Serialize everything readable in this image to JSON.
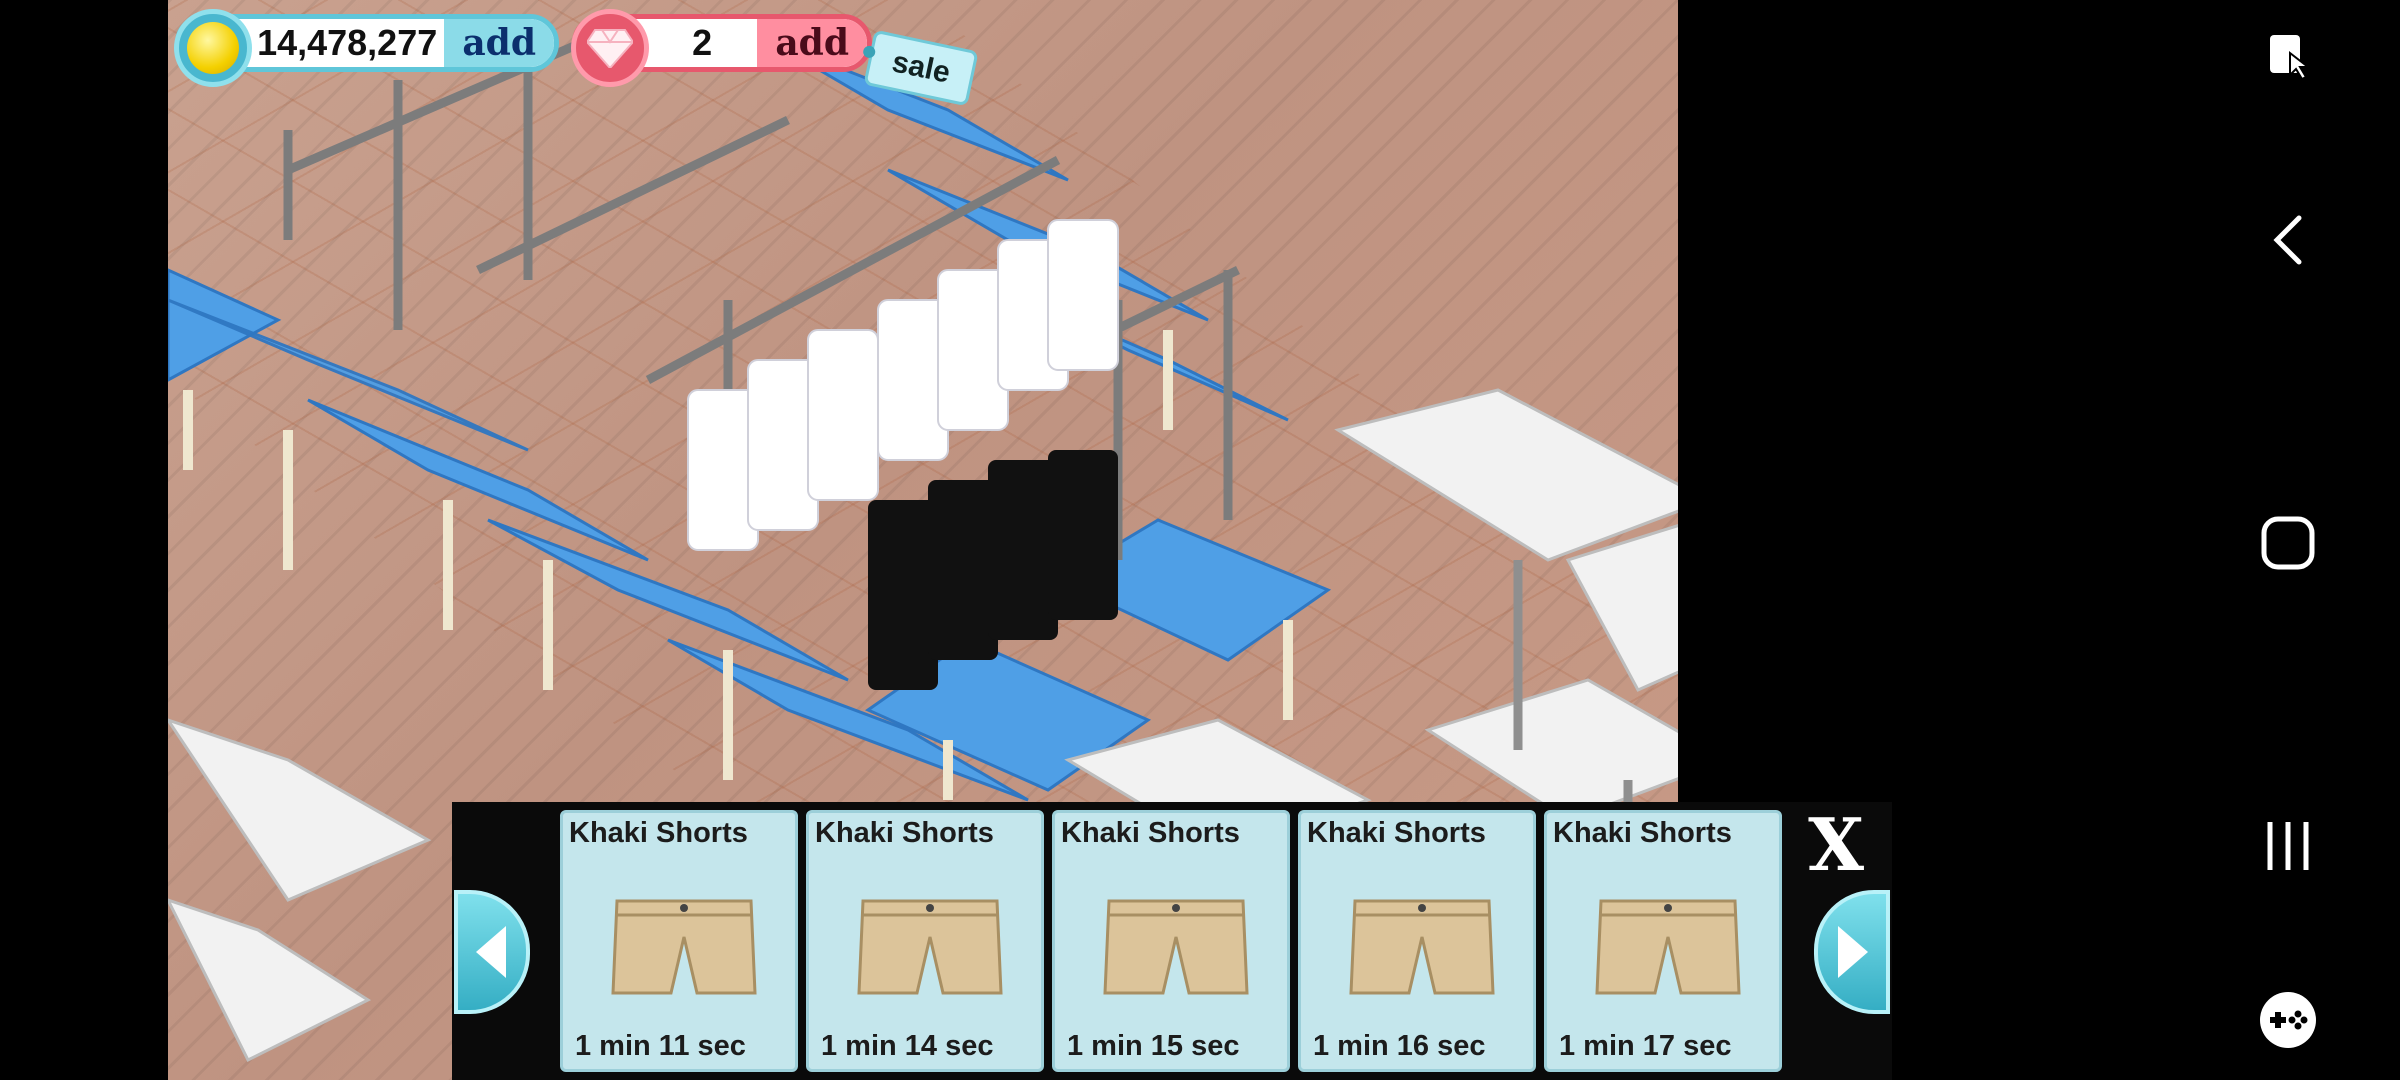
{
  "hud": {
    "coins": "14,478,277",
    "coins_add_label": "add",
    "gems": "2",
    "gems_add_label": "add",
    "sale_label": "sale"
  },
  "tray": {
    "items": [
      {
        "name": "Khaki Shorts",
        "time": "1 min 11 sec"
      },
      {
        "name": "Khaki Shorts",
        "time": "1 min 14 sec"
      },
      {
        "name": "Khaki Shorts",
        "time": "1 min 15 sec"
      },
      {
        "name": "Khaki Shorts",
        "time": "1 min 16 sec"
      },
      {
        "name": "Khaki Shorts",
        "time": "1 min 17 sec"
      }
    ],
    "close_label": "X"
  },
  "icons": {
    "coin": "coin-icon",
    "gem": "gem-icon",
    "prev": "chevron-left-icon",
    "next": "chevron-right-icon",
    "sys_screenshot": "screenshot-icon",
    "sys_back": "back-icon",
    "sys_home": "home-icon",
    "sys_recents": "recents-icon",
    "sys_game": "gamepad-icon"
  },
  "colors": {
    "accent_teal": "#5fc6d9",
    "accent_pink": "#e7586d",
    "card_bg": "#c4e6ec"
  }
}
